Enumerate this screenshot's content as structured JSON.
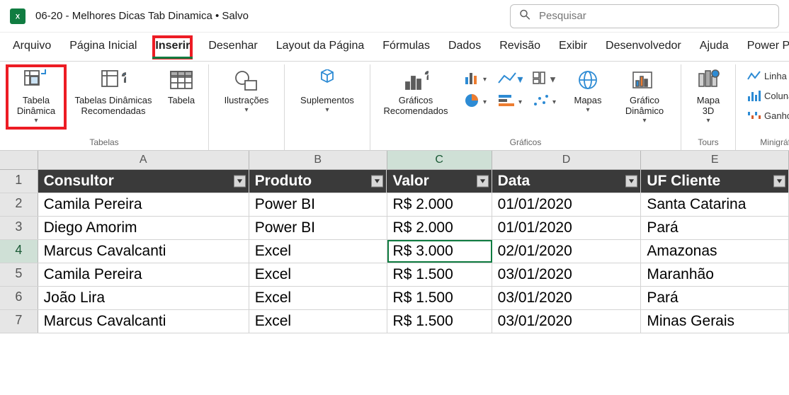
{
  "app": {
    "doc_title": "06-20 - Melhores Dicas Tab Dinamica • Salvo",
    "search_placeholder": "Pesquisar"
  },
  "menu_tabs": [
    "Arquivo",
    "Página Inicial",
    "Inserir",
    "Desenhar",
    "Layout da Página",
    "Fórmulas",
    "Dados",
    "Revisão",
    "Exibir",
    "Desenvolvedor",
    "Ajuda",
    "Power Piv"
  ],
  "active_tab": "Inserir",
  "ribbon": {
    "tables_group": {
      "label": "Tabelas",
      "pivot_table": "Tabela\nDinâmica",
      "recommended_pivot": "Tabelas Dinâmicas\nRecomendadas",
      "table": "Tabela"
    },
    "illustrations": "Ilustrações",
    "addins": "Suplementos",
    "charts_group": {
      "label": "Gráficos",
      "recommended": "Gráficos\nRecomendados",
      "maps": "Mapas",
      "pivot_chart": "Gráfico\nDinâmico"
    },
    "tours_group": {
      "label": "Tours",
      "map3d": "Mapa\n3D"
    },
    "sparklines_group": {
      "label": "Minigráficos",
      "line": "Linha",
      "column": "Coluna",
      "winloss": "Ganhos/Perd"
    }
  },
  "columns": [
    "A",
    "B",
    "C",
    "D",
    "E"
  ],
  "table": {
    "headers": [
      "Consultor",
      "Produto",
      "Valor",
      "Data",
      "UF Cliente"
    ],
    "rows": [
      {
        "n": 2,
        "consultor": "Camila Pereira",
        "produto": "Power BI",
        "valor": "R$ 2.000",
        "data": "01/01/2020",
        "uf": "Santa Catarina"
      },
      {
        "n": 3,
        "consultor": "Diego Amorim",
        "produto": "Power BI",
        "valor": "R$ 2.000",
        "data": "01/01/2020",
        "uf": "Pará"
      },
      {
        "n": 4,
        "consultor": "Marcus Cavalcanti",
        "produto": "Excel",
        "valor": "R$ 3.000",
        "data": "02/01/2020",
        "uf": "Amazonas"
      },
      {
        "n": 5,
        "consultor": "Camila Pereira",
        "produto": "Excel",
        "valor": "R$ 1.500",
        "data": "03/01/2020",
        "uf": "Maranhão"
      },
      {
        "n": 6,
        "consultor": "João Lira",
        "produto": "Excel",
        "valor": "R$ 1.500",
        "data": "03/01/2020",
        "uf": "Pará"
      },
      {
        "n": 7,
        "consultor": "Marcus Cavalcanti",
        "produto": "Excel",
        "valor": "R$ 1.500",
        "data": "03/01/2020",
        "uf": "Minas Gerais"
      }
    ]
  },
  "selected_cell": {
    "row": 4,
    "col": "C"
  }
}
